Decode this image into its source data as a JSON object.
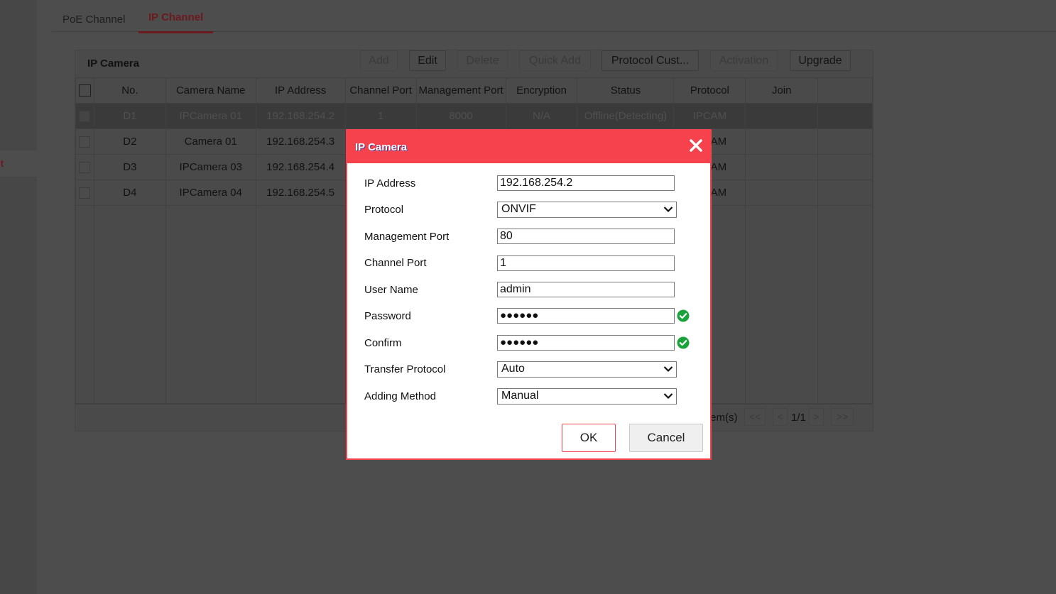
{
  "sidebar": {
    "active_item_fragment": "nt"
  },
  "tabs": [
    {
      "label": "PoE Channel",
      "active": false
    },
    {
      "label": "IP Channel",
      "active": true
    }
  ],
  "panel": {
    "title": "IP Camera",
    "toolbar": [
      {
        "label": "Add",
        "enabled": false
      },
      {
        "label": "Edit",
        "enabled": true
      },
      {
        "label": "Delete",
        "enabled": false
      },
      {
        "label": "Quick Add",
        "enabled": false
      },
      {
        "label": "Protocol Cust...",
        "enabled": true
      },
      {
        "label": "Activation",
        "enabled": false
      },
      {
        "label": "Upgrade",
        "enabled": true
      }
    ],
    "columns": [
      "No.",
      "Camera Name",
      "IP Address",
      "Channel Port",
      "Management Port",
      "Encryption",
      "Status",
      "Protocol",
      "Join",
      ""
    ],
    "rows": [
      {
        "no": "D1",
        "name": "IPCamera 01",
        "ip": "192.168.254.2",
        "channel_port": "1",
        "mgmt_port": "8000",
        "encryption": "N/A",
        "status": "Offline(Detecting)",
        "protocol": "IPCAM",
        "selected": true
      },
      {
        "no": "D2",
        "name": "Camera 01",
        "ip": "192.168.254.3",
        "channel_port": "",
        "mgmt_port": "",
        "encryption": "",
        "status": "",
        "protocol": "IPCAM",
        "selected": false
      },
      {
        "no": "D3",
        "name": "IPCamera 03",
        "ip": "192.168.254.4",
        "channel_port": "",
        "mgmt_port": "",
        "encryption": "",
        "status": "",
        "protocol": "IPCAM",
        "selected": false
      },
      {
        "no": "D4",
        "name": "IPCamera 04",
        "ip": "192.168.254.5",
        "channel_port": "",
        "mgmt_port": "",
        "encryption": "",
        "status": "",
        "protocol": "IPCAM",
        "selected": false
      }
    ],
    "pager": {
      "items_text": "tem(s)",
      "first": "<<",
      "prev": "<",
      "page": "1/1",
      "next": ">",
      "last": ">>"
    }
  },
  "dialog": {
    "title": "IP Camera",
    "fields": {
      "ip_address": {
        "label": "IP Address",
        "value": "192.168.254.2"
      },
      "protocol": {
        "label": "Protocol",
        "value": "ONVIF"
      },
      "management_port": {
        "label": "Management Port",
        "value": "80"
      },
      "channel_port": {
        "label": "Channel Port",
        "value": "1"
      },
      "user_name": {
        "label": "User Name",
        "value": "admin"
      },
      "password": {
        "label": "Password",
        "value": "●●●●●●",
        "valid": true
      },
      "confirm": {
        "label": "Confirm",
        "value": "●●●●●●",
        "valid": true
      },
      "transfer_protocol": {
        "label": "Transfer Protocol",
        "value": "Auto"
      },
      "adding_method": {
        "label": "Adding Method",
        "value": "Manual"
      }
    },
    "ok_label": "OK",
    "cancel_label": "Cancel"
  },
  "colors": {
    "accent": "#f5424c",
    "valid_green": "#1aa33a",
    "tab_active_dimmed": "#6b1a1e"
  }
}
